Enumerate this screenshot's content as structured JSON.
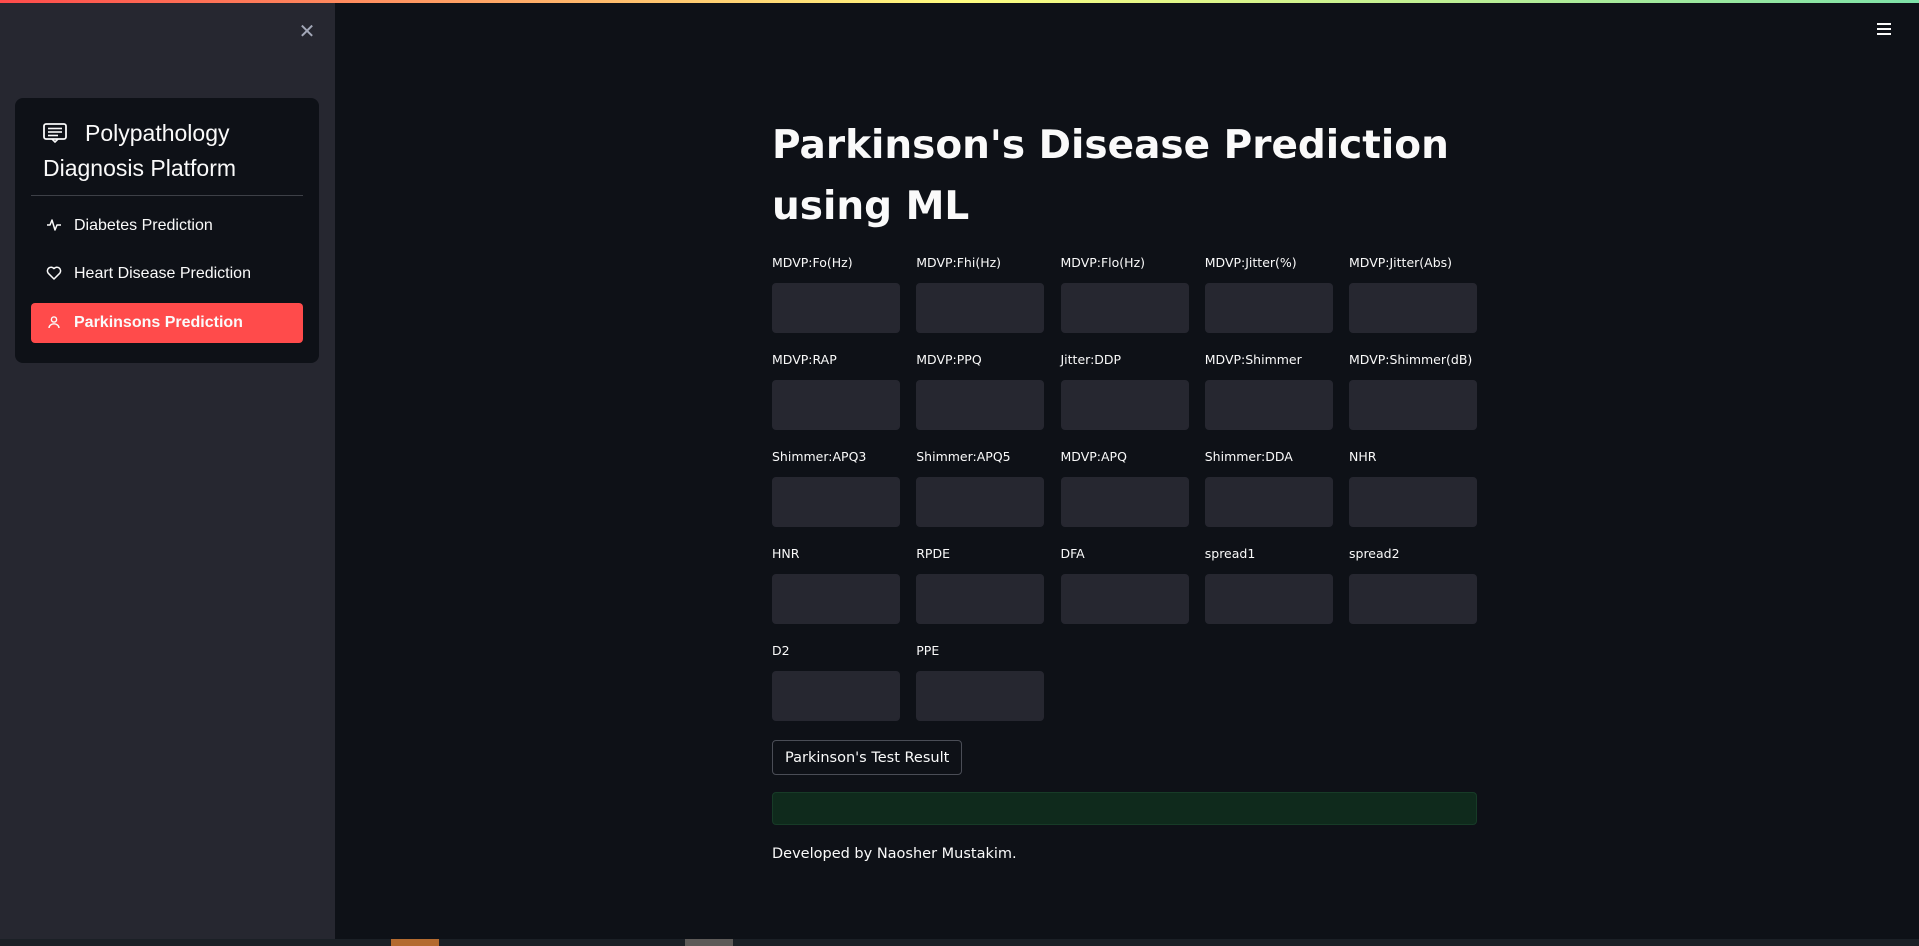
{
  "sidebar": {
    "title": "Polypathology Diagnosis Platform",
    "title_icon": "clipboard-icon",
    "close_icon": "close-icon",
    "items": [
      {
        "label": "Diabetes Prediction",
        "icon": "activity-icon"
      },
      {
        "label": "Heart Disease Prediction",
        "icon": "heart-icon"
      },
      {
        "label": "Parkinsons Prediction",
        "icon": "person-icon",
        "active": true
      }
    ],
    "active_color": "#ff4b4b"
  },
  "header": {
    "menu_icon": "hamburger-icon"
  },
  "main": {
    "title": "Parkinson's Disease Prediction using ML",
    "fields": [
      {
        "label": "MDVP:Fo(Hz)",
        "value": ""
      },
      {
        "label": "MDVP:Fhi(Hz)",
        "value": ""
      },
      {
        "label": "MDVP:Flo(Hz)",
        "value": ""
      },
      {
        "label": "MDVP:Jitter(%)",
        "value": ""
      },
      {
        "label": "MDVP:Jitter(Abs)",
        "value": ""
      },
      {
        "label": "MDVP:RAP",
        "value": ""
      },
      {
        "label": "MDVP:PPQ",
        "value": ""
      },
      {
        "label": "Jitter:DDP",
        "value": ""
      },
      {
        "label": "MDVP:Shimmer",
        "value": ""
      },
      {
        "label": "MDVP:Shimmer(dB)",
        "value": ""
      },
      {
        "label": "Shimmer:APQ3",
        "value": ""
      },
      {
        "label": "Shimmer:APQ5",
        "value": ""
      },
      {
        "label": "MDVP:APQ",
        "value": ""
      },
      {
        "label": "Shimmer:DDA",
        "value": ""
      },
      {
        "label": "NHR",
        "value": ""
      },
      {
        "label": "HNR",
        "value": ""
      },
      {
        "label": "RPDE",
        "value": ""
      },
      {
        "label": "DFA",
        "value": ""
      },
      {
        "label": "spread1",
        "value": ""
      },
      {
        "label": "spread2",
        "value": ""
      },
      {
        "label": "D2",
        "value": ""
      },
      {
        "label": "PPE",
        "value": ""
      }
    ],
    "button_label": "Parkinson's Test Result",
    "result_text": "",
    "footer": "Developed by Naosher Mustakim."
  },
  "colors": {
    "background": "#0e1117",
    "sidebar": "#262730",
    "accent": "#ff4b4b",
    "success_bg": "#0f2a1c"
  }
}
